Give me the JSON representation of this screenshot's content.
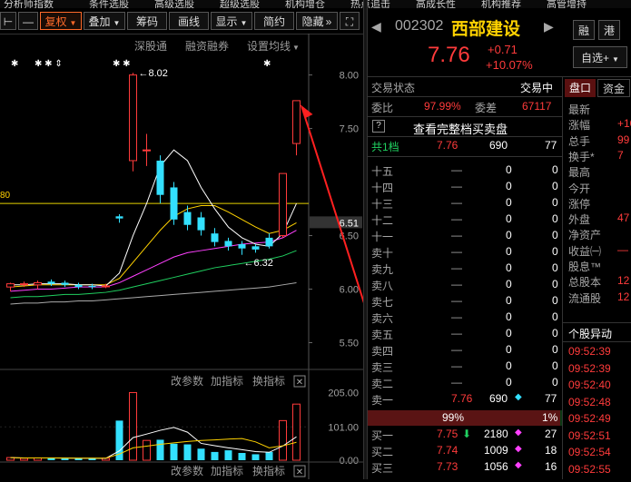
{
  "topnav": [
    "分析师指数",
    "条件选股",
    "高级选股",
    "超级选股",
    "机构增仓",
    "热点追击",
    "高成长性",
    "机构推荐",
    "高管增持"
  ],
  "toolbar": {
    "arrow_left": "⊢",
    "minus": "—",
    "fuquan": "复权",
    "diejia": "叠加",
    "chouma": "筹码",
    "huaxian": "画线",
    "xianshi": "显示",
    "jianyue": "简约",
    "yincang": "隐藏",
    "expand": "»",
    "fullscreen": "⛶"
  },
  "chart": {
    "links": [
      "深股通",
      "融资融券",
      "设置均线"
    ],
    "price_ticks": [
      "8.00",
      "7.50",
      "6.51",
      "6.50",
      "6.00",
      "5.50"
    ],
    "current_price_marker": "6.51",
    "high_annotation": "8.02",
    "low_annotation": "6.32",
    "left_value": "80",
    "star_marks": [
      "✱",
      "✱ ✱ ⇕",
      "✱ ✱",
      "✱"
    ],
    "volume_panel": {
      "links": [
        "改参数",
        "加指标",
        "换指标"
      ],
      "ticks": [
        "205.00",
        "101.00",
        "0.00"
      ],
      "close": "✕"
    },
    "bottom_panel": {
      "links": [
        "改参数",
        "加指标",
        "换指标"
      ],
      "close": "✕"
    },
    "colors": {
      "up": "#ff3b3b",
      "down": "#33e0ff",
      "ma5": "#ffffff",
      "ma10": "#ffd200",
      "ma20": "#ff40ff",
      "ma30": "#20d060",
      "ma60": "#aaaaaa"
    },
    "candles": [
      {
        "o": 6.02,
        "c": 6.05,
        "h": 6.06,
        "l": 5.98
      },
      {
        "o": 6.05,
        "c": 6.05,
        "h": 6.07,
        "l": 6.02
      },
      {
        "o": 6.04,
        "c": 6.06,
        "h": 6.08,
        "l": 6.0
      },
      {
        "o": 6.07,
        "c": 6.05,
        "h": 6.09,
        "l": 6.03
      },
      {
        "o": 6.06,
        "c": 6.04,
        "h": 6.08,
        "l": 6.02
      },
      {
        "o": 6.04,
        "c": 6.02,
        "h": 6.06,
        "l": 6.0
      },
      {
        "o": 6.03,
        "c": 6.02,
        "h": 6.05,
        "l": 6.0
      },
      {
        "o": 6.03,
        "c": 6.03,
        "h": 6.05,
        "l": 6.01
      },
      {
        "o": 6.68,
        "c": 6.66,
        "h": 6.7,
        "l": 6.62
      },
      {
        "o": 7.2,
        "c": 8.0,
        "h": 8.02,
        "l": 7.1
      },
      {
        "o": 7.3,
        "c": 7.3,
        "h": 7.45,
        "l": 7.15
      },
      {
        "o": 7.2,
        "c": 6.88,
        "h": 7.25,
        "l": 6.8
      },
      {
        "o": 6.95,
        "c": 6.65,
        "h": 7.0,
        "l": 6.6
      },
      {
        "o": 6.72,
        "c": 6.6,
        "h": 6.78,
        "l": 6.55
      },
      {
        "o": 6.67,
        "c": 6.55,
        "h": 6.72,
        "l": 6.5
      },
      {
        "o": 6.52,
        "c": 6.44,
        "h": 6.57,
        "l": 6.4
      },
      {
        "o": 6.45,
        "c": 6.4,
        "h": 6.48,
        "l": 6.36
      },
      {
        "o": 6.42,
        "c": 6.38,
        "h": 6.45,
        "l": 6.32
      },
      {
        "o": 6.4,
        "c": 6.37,
        "h": 6.42,
        "l": 6.34
      },
      {
        "o": 6.48,
        "c": 6.4,
        "h": 6.52,
        "l": 6.38
      },
      {
        "o": 6.5,
        "c": 7.08,
        "h": 7.08,
        "l": 6.48
      },
      {
        "o": 7.36,
        "c": 7.76,
        "h": 7.76,
        "l": 7.25
      }
    ],
    "volumes": [
      8,
      6,
      7,
      6,
      5,
      6,
      5,
      6,
      120,
      205,
      60,
      62,
      50,
      48,
      35,
      25,
      30,
      22,
      18,
      25,
      120,
      170
    ],
    "ma5": [
      6.04,
      6.04,
      6.05,
      6.05,
      6.05,
      6.04,
      6.04,
      6.03,
      6.15,
      6.5,
      6.8,
      7.15,
      7.3,
      7.2,
      6.95,
      6.75,
      6.58,
      6.48,
      6.42,
      6.4,
      6.52,
      6.8
    ],
    "ma10": [
      6.02,
      6.03,
      6.04,
      6.04,
      6.04,
      6.04,
      6.04,
      6.04,
      6.1,
      6.25,
      6.4,
      6.55,
      6.68,
      6.75,
      6.78,
      6.78,
      6.72,
      6.65,
      6.58,
      6.52,
      6.55,
      6.62
    ],
    "ma20": [
      5.98,
      5.99,
      6.0,
      6.0,
      6.01,
      6.02,
      6.02,
      6.02,
      6.06,
      6.12,
      6.18,
      6.24,
      6.3,
      6.34,
      6.36,
      6.38,
      6.4,
      6.42,
      6.43,
      6.44,
      6.48,
      6.55
    ],
    "ma30": [
      5.92,
      5.93,
      5.93,
      5.94,
      5.95,
      5.95,
      5.96,
      5.97,
      5.99,
      6.02,
      6.05,
      6.08,
      6.11,
      6.14,
      6.17,
      6.2,
      6.22,
      6.24,
      6.26,
      6.28,
      6.31,
      6.36
    ],
    "ma60": [
      5.86,
      5.87,
      5.87,
      5.88,
      5.88,
      5.89,
      5.89,
      5.9,
      5.91,
      5.92,
      5.93,
      5.94,
      5.95,
      5.96,
      5.97,
      5.98,
      5.99,
      6.0,
      6.01,
      6.02,
      6.04,
      6.06
    ],
    "horizontal_line_price": 6.8,
    "ylim": [
      5.25,
      8.2
    ]
  },
  "quote": {
    "code": "002302",
    "name": "西部建设",
    "price": "7.76",
    "change": "+0.71",
    "change_pct": "+10.07%",
    "btn_rong": "融",
    "btn_gang": "港",
    "zixuan": "自选+",
    "status_label": "交易状态",
    "status_value": "交易中",
    "weibi_label": "委比",
    "weibi_value": "97.99%",
    "weicha_label": "委差",
    "weicha_value": "67117",
    "full_book": "查看完整档买卖盘",
    "total_levels_label": "共1档",
    "total_levels_price": "7.76",
    "total_levels_qty": "690",
    "total_levels_count": "77",
    "sell_levels": [
      {
        "label": "十五",
        "price": "—",
        "qty": "0",
        "n": "0"
      },
      {
        "label": "十四",
        "price": "—",
        "qty": "0",
        "n": "0"
      },
      {
        "label": "十三",
        "price": "—",
        "qty": "0",
        "n": "0"
      },
      {
        "label": "十二",
        "price": "—",
        "qty": "0",
        "n": "0"
      },
      {
        "label": "十一",
        "price": "—",
        "qty": "0",
        "n": "0"
      },
      {
        "label": "卖十",
        "price": "—",
        "qty": "0",
        "n": "0"
      },
      {
        "label": "卖九",
        "price": "—",
        "qty": "0",
        "n": "0"
      },
      {
        "label": "卖八",
        "price": "—",
        "qty": "0",
        "n": "0"
      },
      {
        "label": "卖七",
        "price": "—",
        "qty": "0",
        "n": "0"
      },
      {
        "label": "卖六",
        "price": "—",
        "qty": "0",
        "n": "0"
      },
      {
        "label": "卖五",
        "price": "—",
        "qty": "0",
        "n": "0"
      },
      {
        "label": "卖四",
        "price": "—",
        "qty": "0",
        "n": "0"
      },
      {
        "label": "卖三",
        "price": "—",
        "qty": "0",
        "n": "0"
      },
      {
        "label": "卖二",
        "price": "—",
        "qty": "0",
        "n": "0"
      },
      {
        "label": "卖一",
        "price": "7.76",
        "qty": "690",
        "n": "77"
      }
    ],
    "ratio_bar": {
      "buy_pct": "99%",
      "sell_pct": "1%",
      "buy_fraction": 0.99
    },
    "buy_levels": [
      {
        "label": "买一",
        "price": "7.75",
        "arrow": "⬇",
        "qty": "2180",
        "n": "27"
      },
      {
        "label": "买二",
        "price": "7.74",
        "qty": "1009",
        "n": "18"
      },
      {
        "label": "买三",
        "price": "7.73",
        "qty": "1056",
        "n": "16"
      }
    ],
    "tabs": [
      "盘口",
      "资金"
    ],
    "stats": [
      {
        "label": "最新",
        "value": ""
      },
      {
        "label": "涨幅",
        "value": "+10"
      },
      {
        "label": "总手",
        "value": "99"
      },
      {
        "label": "换手*",
        "value": "7"
      },
      {
        "label": "最高",
        "value": ""
      },
      {
        "label": "今开",
        "value": ""
      },
      {
        "label": "涨停",
        "value": ""
      },
      {
        "label": "外盘",
        "value": "47"
      },
      {
        "label": "净资产",
        "value": ""
      },
      {
        "label": "收益㈠",
        "value": "—"
      },
      {
        "label": "股息™",
        "value": ""
      },
      {
        "label": "总股本",
        "value": "12"
      },
      {
        "label": "流通股",
        "value": "12"
      }
    ],
    "movement_title": "个股异动",
    "movement_times": [
      "09:52:39",
      "09:52:39",
      "09:52:40",
      "09:52:48",
      "09:52:49",
      "09:52:51",
      "09:52:54",
      "09:52:55"
    ]
  }
}
